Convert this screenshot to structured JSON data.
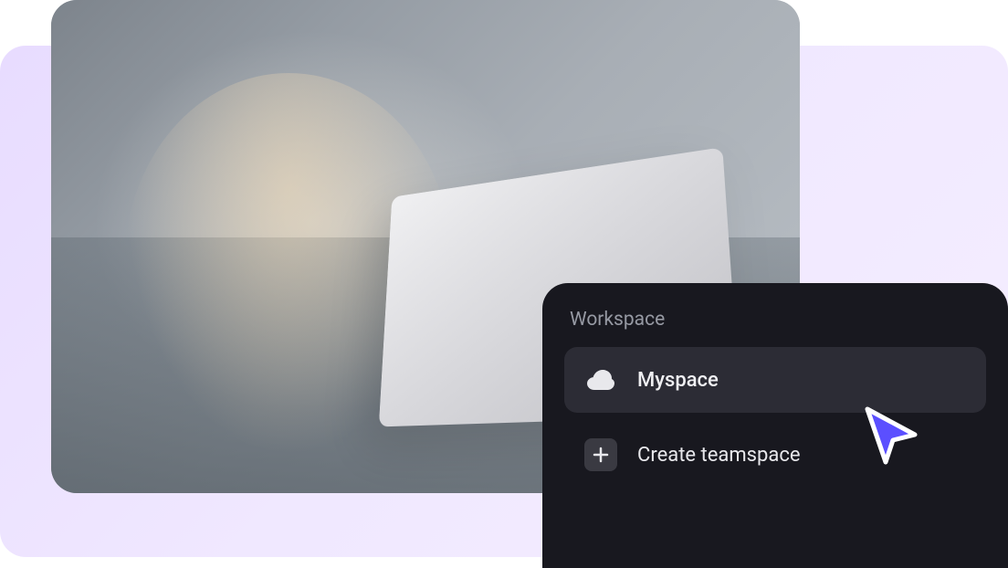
{
  "menu": {
    "header": "Workspace",
    "items": [
      {
        "icon": "cloud-icon",
        "label": "Myspace",
        "selected": true
      },
      {
        "icon": "plus-icon",
        "label": "Create teamspace",
        "selected": false
      }
    ]
  },
  "colors": {
    "menu_bg": "#18181f",
    "menu_item_selected": "#2c2c35",
    "menu_text": "#f0f0f3",
    "menu_header": "#9699a3",
    "cursor_fill": "#5b4fff",
    "cursor_stroke": "#ffffff",
    "background_gradient_start": "#e8dcff",
    "background_gradient_end": "#f5eeff"
  }
}
